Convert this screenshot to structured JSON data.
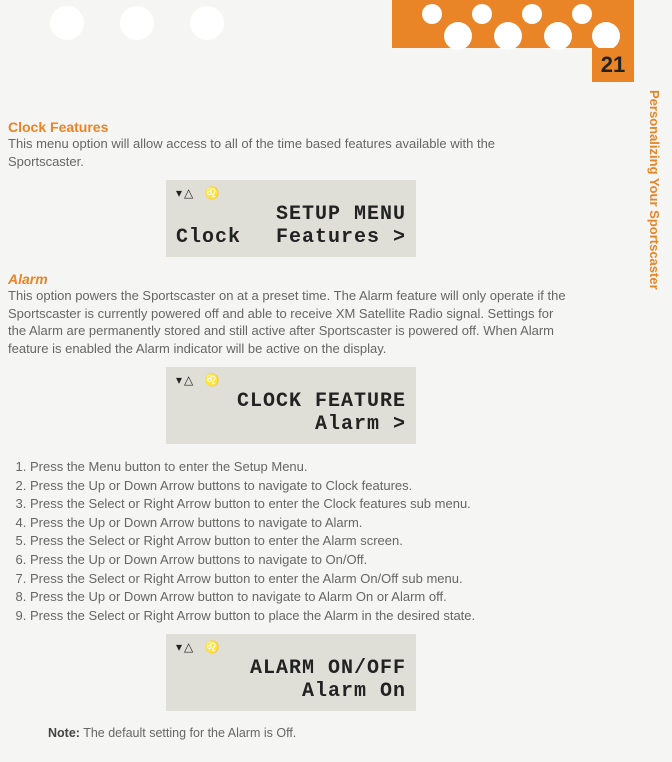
{
  "page_number": "21",
  "side_label": "Personalizing Your Sportscaster",
  "clock_features": {
    "heading": "Clock Features",
    "body": "This menu option will allow access to all of the time based features available with the Sportscaster."
  },
  "lcd1": {
    "status": "▾△ ♌",
    "line1": "SETUP MENU",
    "line2_left": "Clock",
    "line2_right": "Features >"
  },
  "alarm": {
    "heading": "Alarm",
    "body": "This option powers the Sportscaster on at a preset time. The Alarm feature will only operate if the Sportscaster is currently powered off and able to receive XM Satellite Radio signal. Settings for the Alarm are permanently stored and still active after Sportscaster is powered off.  When Alarm feature is enabled the Alarm indicator will be active on the display."
  },
  "lcd2": {
    "status": "▾△ ♌",
    "line1": "CLOCK FEATURE",
    "line2": "Alarm >"
  },
  "steps": [
    "Press the Menu button to enter the Setup Menu.",
    "Press the Up or Down Arrow buttons to navigate to Clock features.",
    "Press the Select or Right Arrow button to enter the Clock features sub menu.",
    "Press the Up or Down Arrow buttons to navigate to Alarm.",
    "Press the Select or Right Arrow button to enter the Alarm screen.",
    "Press the Up or Down Arrow buttons to navigate to On/Off.",
    "Press the Select or Right Arrow button to enter the Alarm On/Off sub menu.",
    "Press the Up or Down Arrow button to navigate to Alarm On or Alarm off.",
    "Press the Select or Right Arrow button to place the Alarm in the desired state."
  ],
  "lcd3": {
    "status": "▾△ ♌",
    "line1": "ALARM ON/OFF",
    "line2": "Alarm On"
  },
  "note": {
    "label": "Note:",
    "text": "  The default setting for the Alarm is Off."
  }
}
